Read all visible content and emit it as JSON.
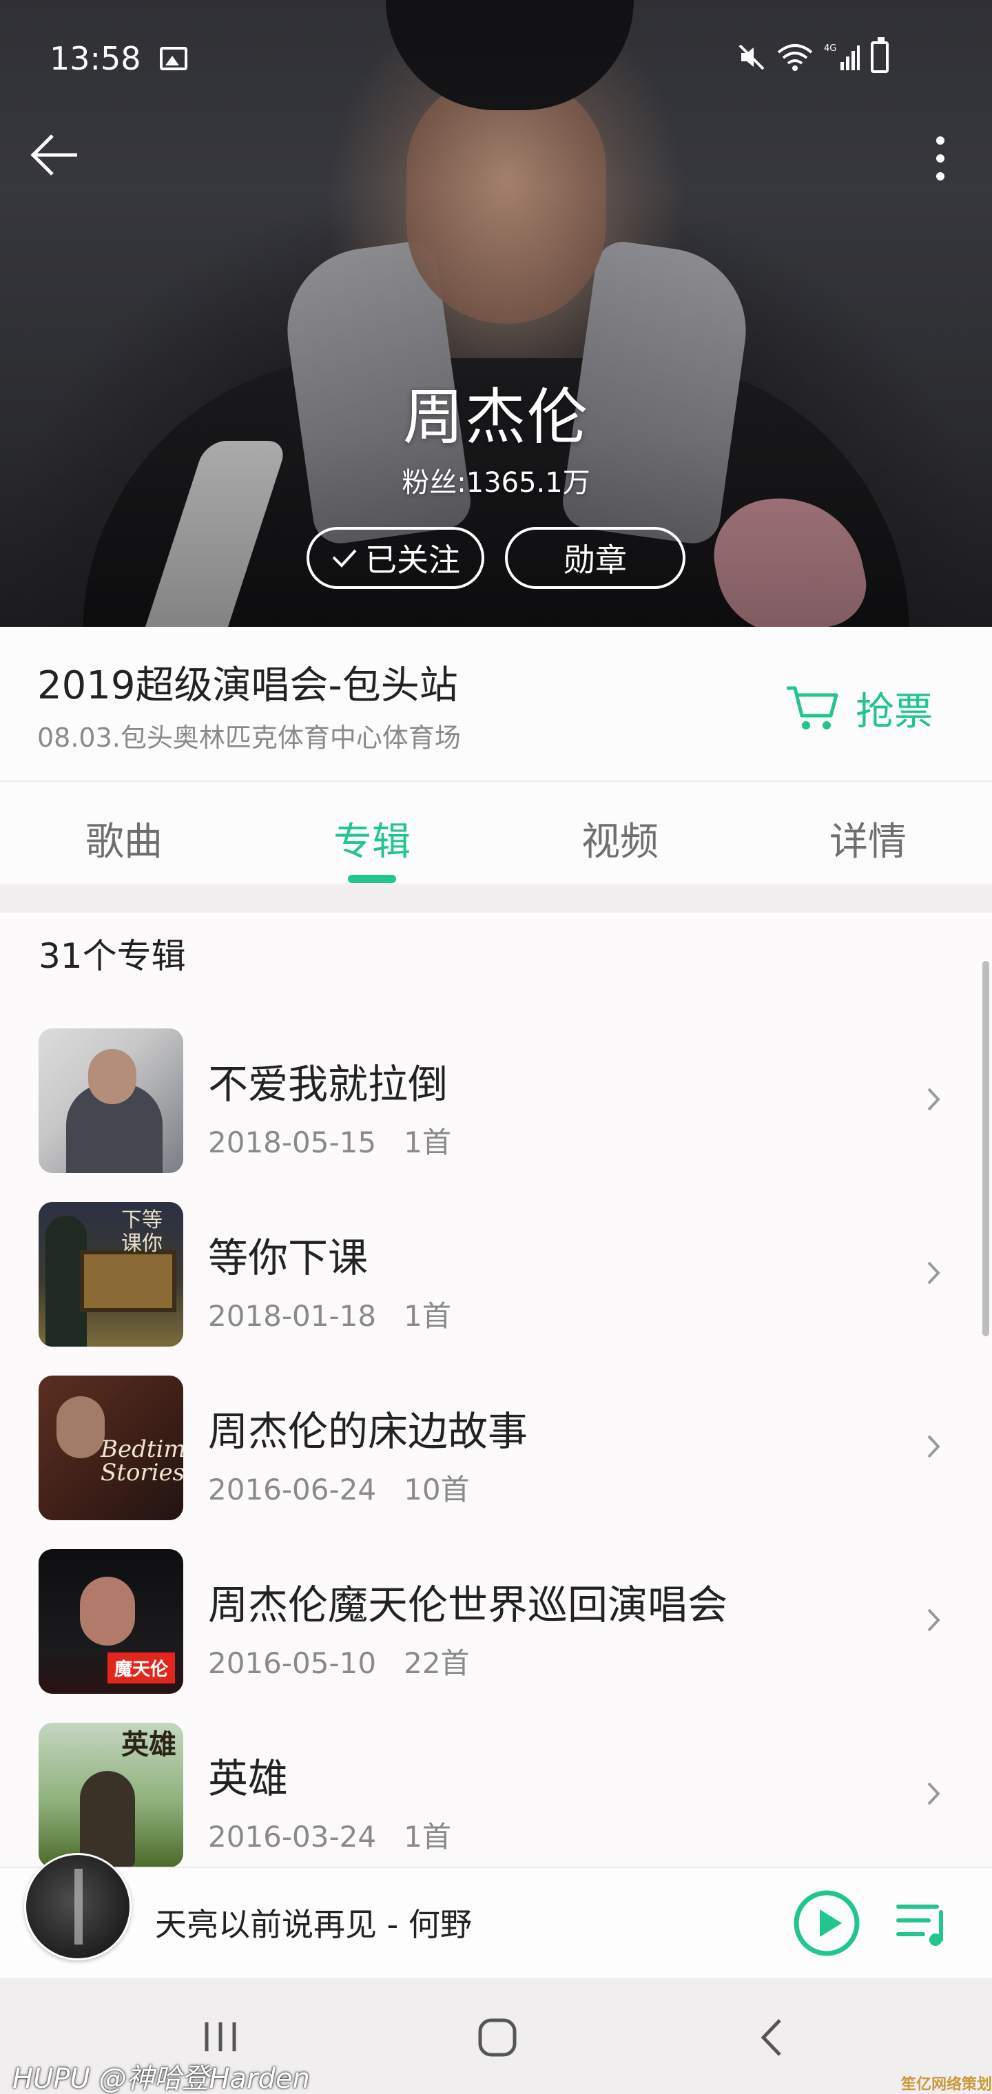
{
  "status_bar": {
    "time": "13:58",
    "network": "4G"
  },
  "hero": {
    "artist_name": "周杰伦",
    "fans_text": "粉丝:1365.1万",
    "follow_label": "已关注",
    "medal_label": "勋章"
  },
  "concert": {
    "title": "2019超级演唱会-包头站",
    "subtitle": "08.03.包头奥林匹克体育中心体育场",
    "ticket_label": "抢票"
  },
  "tabs": [
    {
      "label": "歌曲",
      "active": false
    },
    {
      "label": "专辑",
      "active": true
    },
    {
      "label": "视频",
      "active": false
    },
    {
      "label": "详情",
      "active": false
    }
  ],
  "album_count": "31个专辑",
  "albums": [
    {
      "title": "不爱我就拉倒",
      "date": "2018-05-15",
      "tracks": "1首"
    },
    {
      "title": "等你下课",
      "date": "2018-01-18",
      "tracks": "1首",
      "cover_text": "下等 课你"
    },
    {
      "title": "周杰伦的床边故事",
      "date": "2016-06-24",
      "tracks": "10首",
      "cover_text": "Bedtime Stories"
    },
    {
      "title": "周杰伦魔天伦世界巡回演唱会",
      "date": "2016-05-10",
      "tracks": "22首",
      "cover_text": "魔天伦"
    },
    {
      "title": "英雄",
      "date": "2016-03-24",
      "tracks": "1首",
      "cover_text": "英雄"
    }
  ],
  "player": {
    "now_playing": "天亮以前说再见 - 何野"
  },
  "watermark": "HUPU @神哈登Harden",
  "corner_mark": "笙亿网络策划",
  "colors": {
    "accent": "#20c590",
    "text": "#222222",
    "muted": "#8a8a8a"
  }
}
